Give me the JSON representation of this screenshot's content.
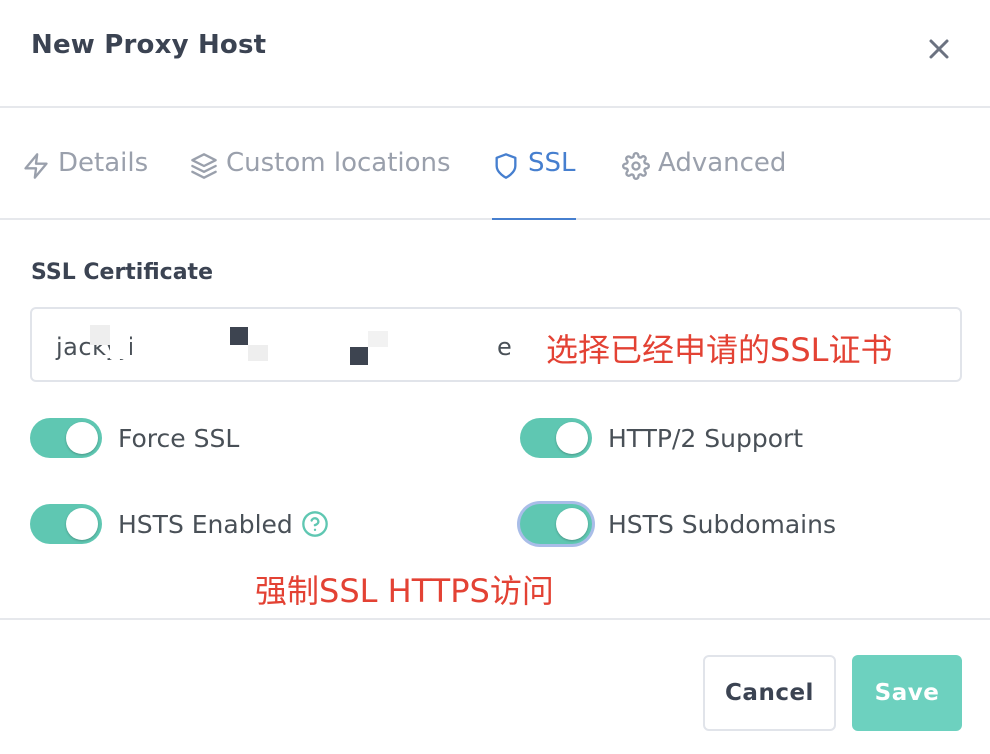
{
  "dialog": {
    "title": "New Proxy Host",
    "close_icon": "close-icon"
  },
  "tabs": [
    {
      "label": "Details",
      "icon": "lightning-icon",
      "active": false
    },
    {
      "label": "Custom locations",
      "icon": "layers-icon",
      "active": false
    },
    {
      "label": "SSL",
      "icon": "shield-icon",
      "active": true
    },
    {
      "label": "Advanced",
      "icon": "gear-icon",
      "active": false
    }
  ],
  "ssl": {
    "certificate_label": "SSL Certificate",
    "certificate_value": "jackyjinchen",
    "certificate_suffix": "e",
    "annotation_select": "选择已经申请的SSL证书",
    "toggles": {
      "force_ssl": {
        "label": "Force SSL",
        "on": true
      },
      "http2": {
        "label": "HTTP/2 Support",
        "on": true
      },
      "hsts_enabled": {
        "label": "HSTS Enabled",
        "on": true
      },
      "hsts_subdomains": {
        "label": "HSTS Subdomains",
        "on": true
      }
    },
    "annotation_toggles": "强制SSL HTTPS访问"
  },
  "footer": {
    "cancel_label": "Cancel",
    "save_label": "Save"
  },
  "colors": {
    "accent_blue": "#467fcf",
    "toggle_on": "#5fc7b2",
    "save_button": "#6dd1bf",
    "annotation_red": "#e34234"
  }
}
